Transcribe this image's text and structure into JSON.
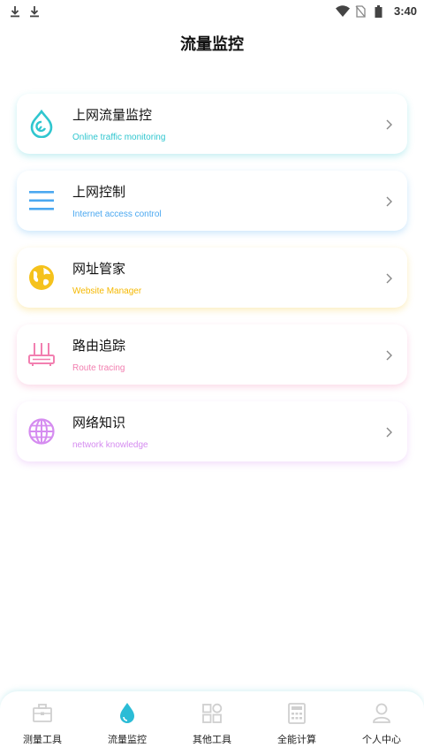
{
  "status_bar": {
    "time": "3:40"
  },
  "page": {
    "title": "流量监控"
  },
  "cards": [
    {
      "title": "上网流量监控",
      "subtitle": "Online traffic monitoring",
      "color": "#2fc6cf",
      "icon": "drop-icon"
    },
    {
      "title": "上网控制",
      "subtitle": "Internet access control",
      "color": "#4ba8f0",
      "icon": "menu-lines-icon"
    },
    {
      "title": "网址管家",
      "subtitle": "Website Manager",
      "color": "#f5c21c",
      "icon": "globe-map-icon"
    },
    {
      "title": "路由追踪",
      "subtitle": "Route tracing",
      "color": "#f27fb0",
      "icon": "router-icon"
    },
    {
      "title": "网络知识",
      "subtitle": "network knowledge",
      "color": "#d58cf0",
      "icon": "globe-grid-icon"
    }
  ],
  "bottom_nav": {
    "items": [
      {
        "label": "测量工具",
        "icon": "toolbox-icon",
        "active": false
      },
      {
        "label": "流量监控",
        "icon": "drop-icon",
        "active": true
      },
      {
        "label": "其他工具",
        "icon": "grid-icon",
        "active": false
      },
      {
        "label": "全能计算",
        "icon": "calculator-icon",
        "active": false
      },
      {
        "label": "个人中心",
        "icon": "person-icon",
        "active": false
      }
    ],
    "active_color": "#2bbcd6",
    "inactive_color": "#cfcfcf"
  }
}
